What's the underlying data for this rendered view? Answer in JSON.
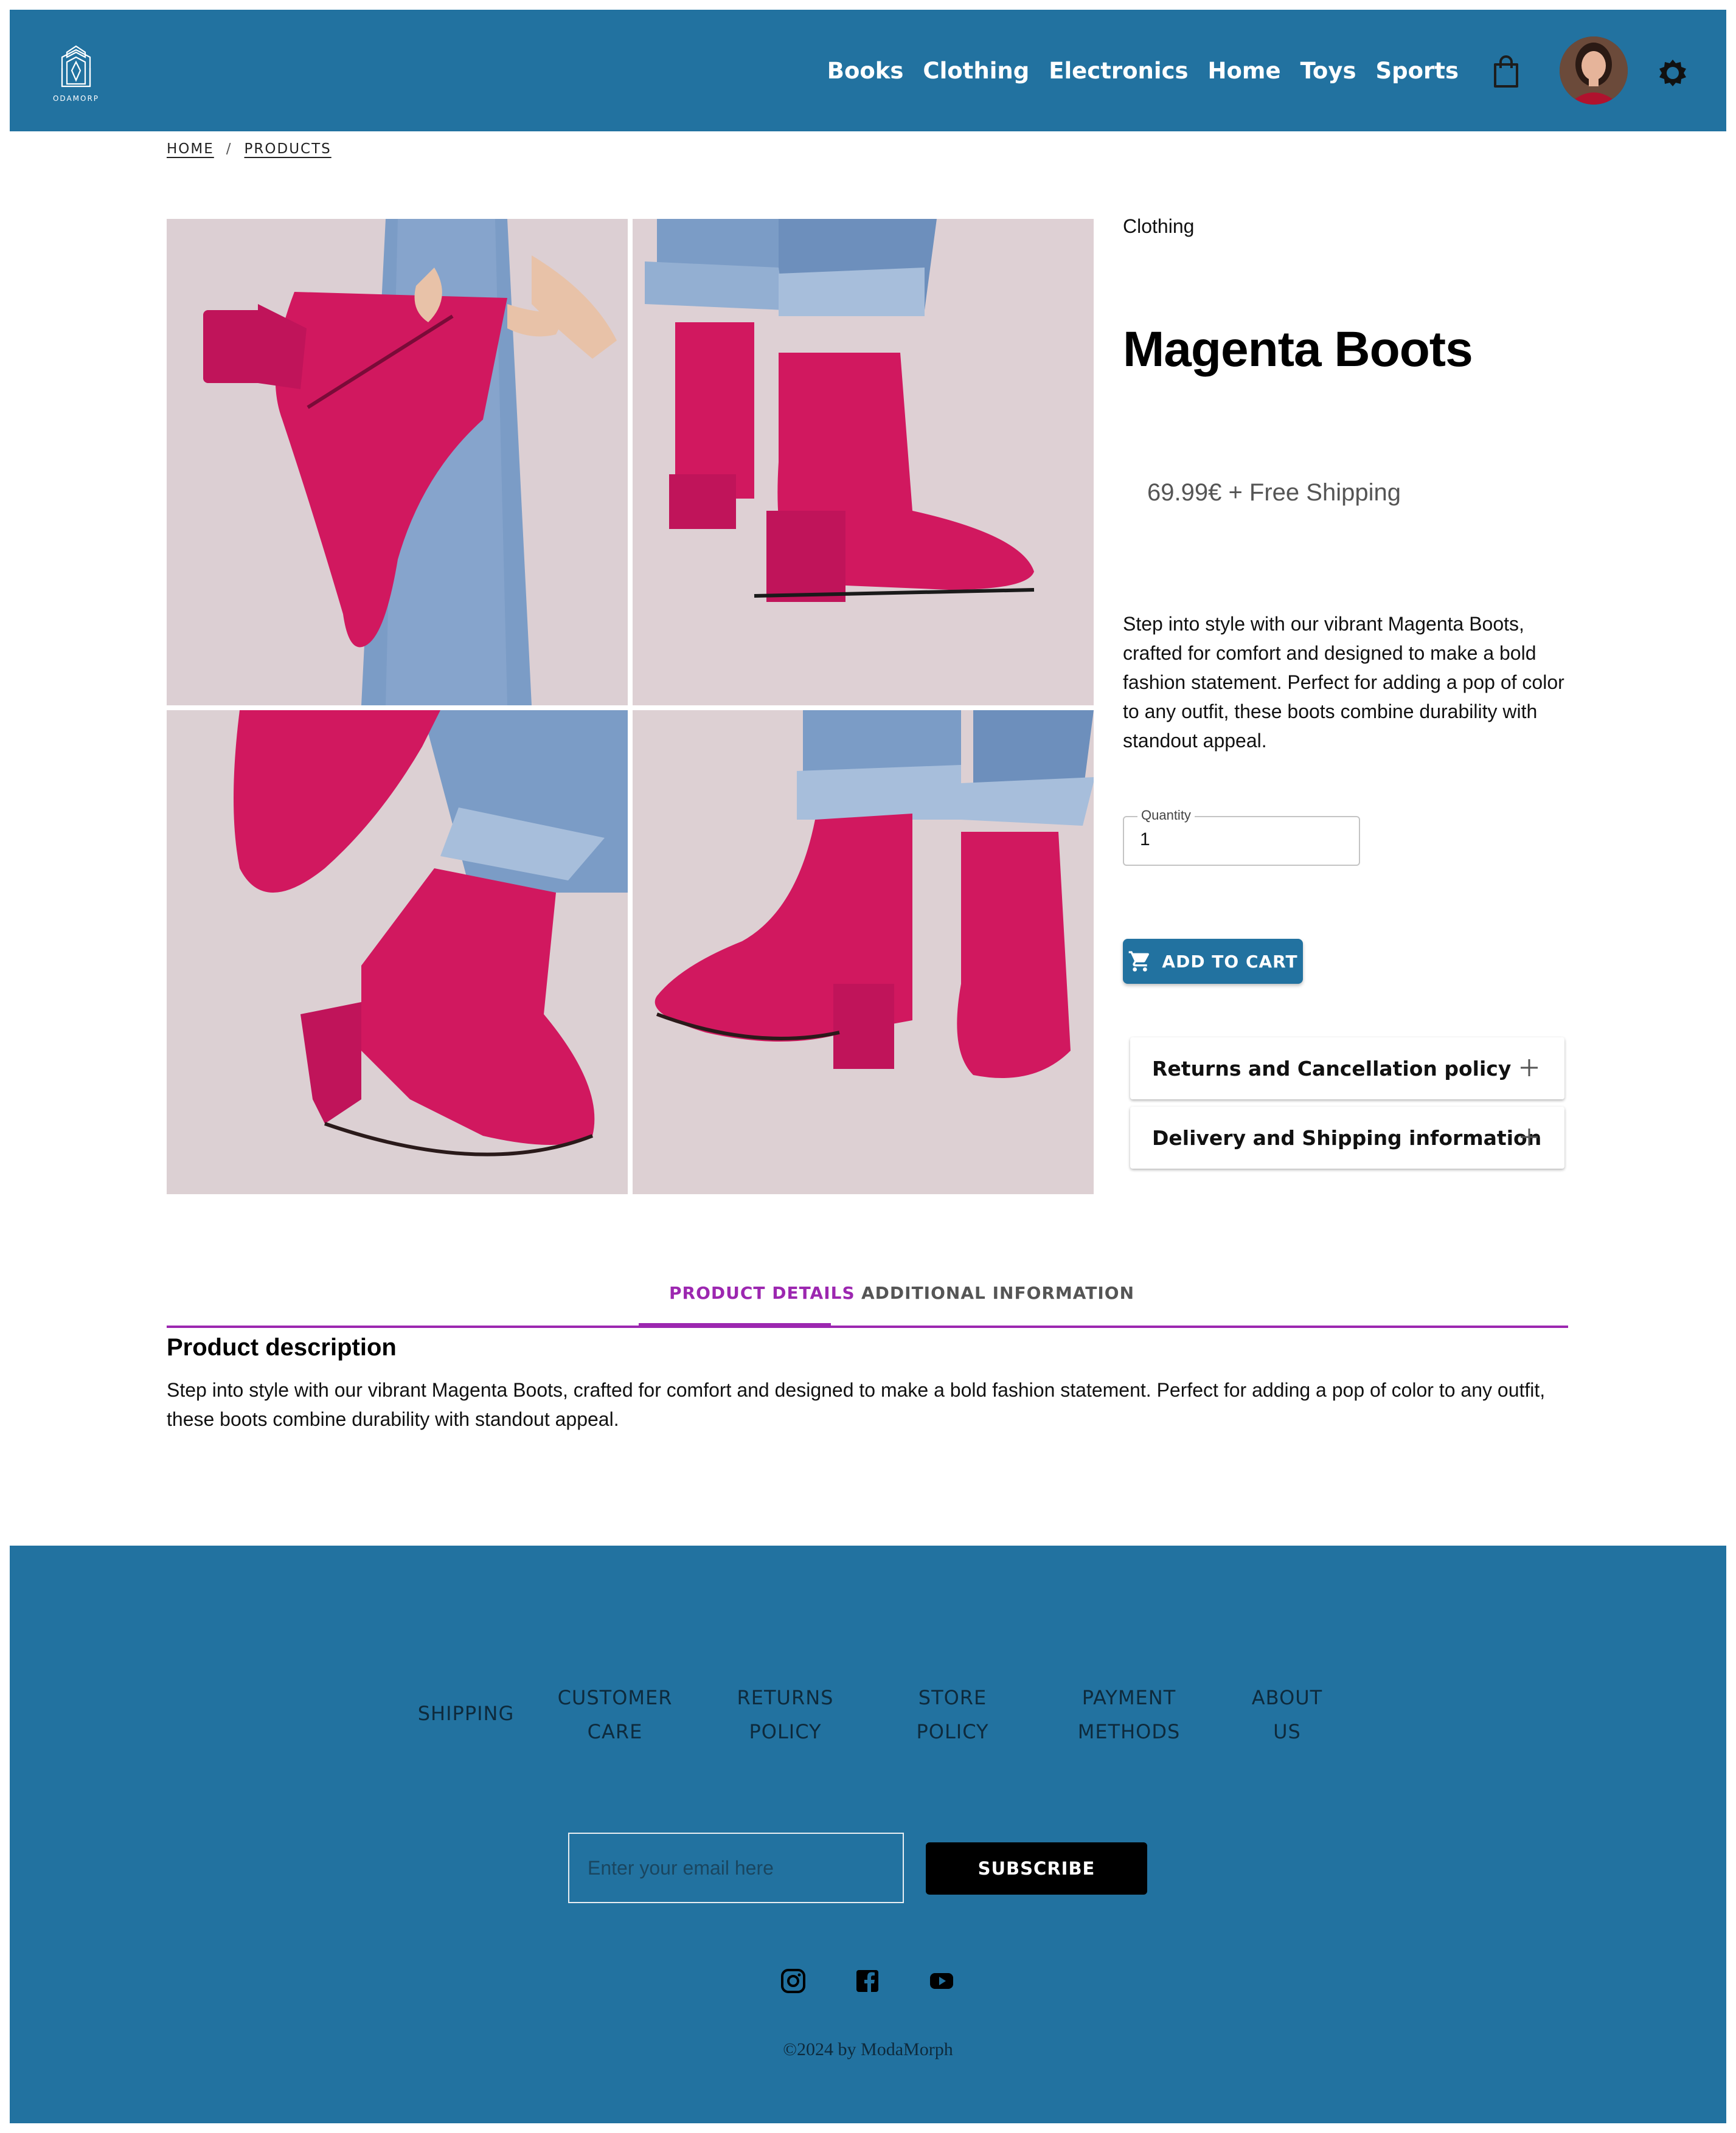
{
  "header": {
    "logo_text": "ODAMORP",
    "nav": [
      "Books",
      "Clothing",
      "Electronics",
      "Home",
      "Toys",
      "Sports"
    ],
    "icons": [
      "shopping-bag-icon",
      "avatar",
      "theme-toggle-icon"
    ],
    "brand_color": "#2272a0"
  },
  "breadcrumb": {
    "home": "HOME",
    "separator": "/",
    "products": "PRODUCTS"
  },
  "product": {
    "category": "Clothing",
    "title": "Magenta Boots",
    "price": "69.99€ + Free Shipping",
    "description": "Step into style with our vibrant Magenta Boots, crafted for comfort and designed to make a bold fashion statement. Perfect for adding a pop of color to any outfit, these boots combine durability with standout appeal.",
    "quantity_label": "Quantity",
    "quantity_value": "1",
    "add_to_cart": "ADD TO CART",
    "accordions": [
      "Returns and Cancellation policy",
      "Delivery and Shipping information"
    ],
    "boot_color": "#d1185f"
  },
  "tabs": {
    "items": [
      "PRODUCT DETAILS",
      "ADDITIONAL INFORMATION"
    ],
    "active": "PRODUCT DETAILS",
    "accent": "#9c27b0"
  },
  "details": {
    "heading": "Product description",
    "text": "Step into style with our vibrant Magenta Boots, crafted for comfort and designed to make a bold fashion statement. Perfect for adding a pop of color to any outfit, these boots combine durability with standout appeal."
  },
  "footer": {
    "links": [
      {
        "line1": "SHIPPING",
        "line2": ""
      },
      {
        "line1": "CUSTOMER",
        "line2": "CARE"
      },
      {
        "line1": "RETURNS",
        "line2": "POLICY"
      },
      {
        "line1": "STORE",
        "line2": "POLICY"
      },
      {
        "line1": "PAYMENT",
        "line2": "METHODS"
      },
      {
        "line1": "ABOUT",
        "line2": "US"
      }
    ],
    "email_placeholder": "Enter your email here",
    "subscribe": "SUBSCRIBE",
    "social": [
      "instagram-icon",
      "facebook-icon",
      "youtube-icon"
    ],
    "copyright": "©2024 by ModaMorph"
  }
}
